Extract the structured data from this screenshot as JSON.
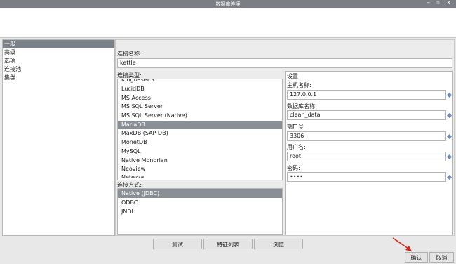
{
  "window": {
    "title": "数据库连接",
    "min_label": "−",
    "max_label": "▫",
    "close_label": "✕"
  },
  "nav": {
    "items": [
      "一般",
      "高级",
      "选项",
      "连接池",
      "集群"
    ]
  },
  "connection_name": {
    "label": "连接名称:",
    "value": "kettle"
  },
  "connection_type": {
    "label": "连接类型:",
    "partial_top": "KingbaseES",
    "items": [
      "LucidDB",
      "MS Access",
      "MS SQL Server",
      "MS SQL Server (Native)",
      "MariaDB",
      "MaxDB (SAP DB)",
      "MonetDB",
      "MySQL",
      "Native Mondrian",
      "Neoview"
    ],
    "partial_bottom": "Netezza",
    "selected": "MariaDB"
  },
  "access_method": {
    "label": "连接方式:",
    "items": [
      "Native (JDBC)",
      "ODBC",
      "JNDI"
    ],
    "selected": "Native (JDBC)"
  },
  "settings": {
    "title": "设置",
    "host_label": "主机名称:",
    "host_value": "127.0.0.1",
    "db_label": "数据库名称:",
    "db_value": "clean_data",
    "port_label": "端口号",
    "port_value": "3306",
    "user_label": "用户名:",
    "user_value": "root",
    "password_label": "密码:",
    "password_value": "••••"
  },
  "buttons": {
    "test": "测试",
    "features": "特征列表",
    "explore": "浏览",
    "ok": "确认",
    "cancel": "取消"
  },
  "colors": {
    "selection": "#8a8f96",
    "arrow": "#d9241a",
    "bullet": "#6b8fc0"
  }
}
